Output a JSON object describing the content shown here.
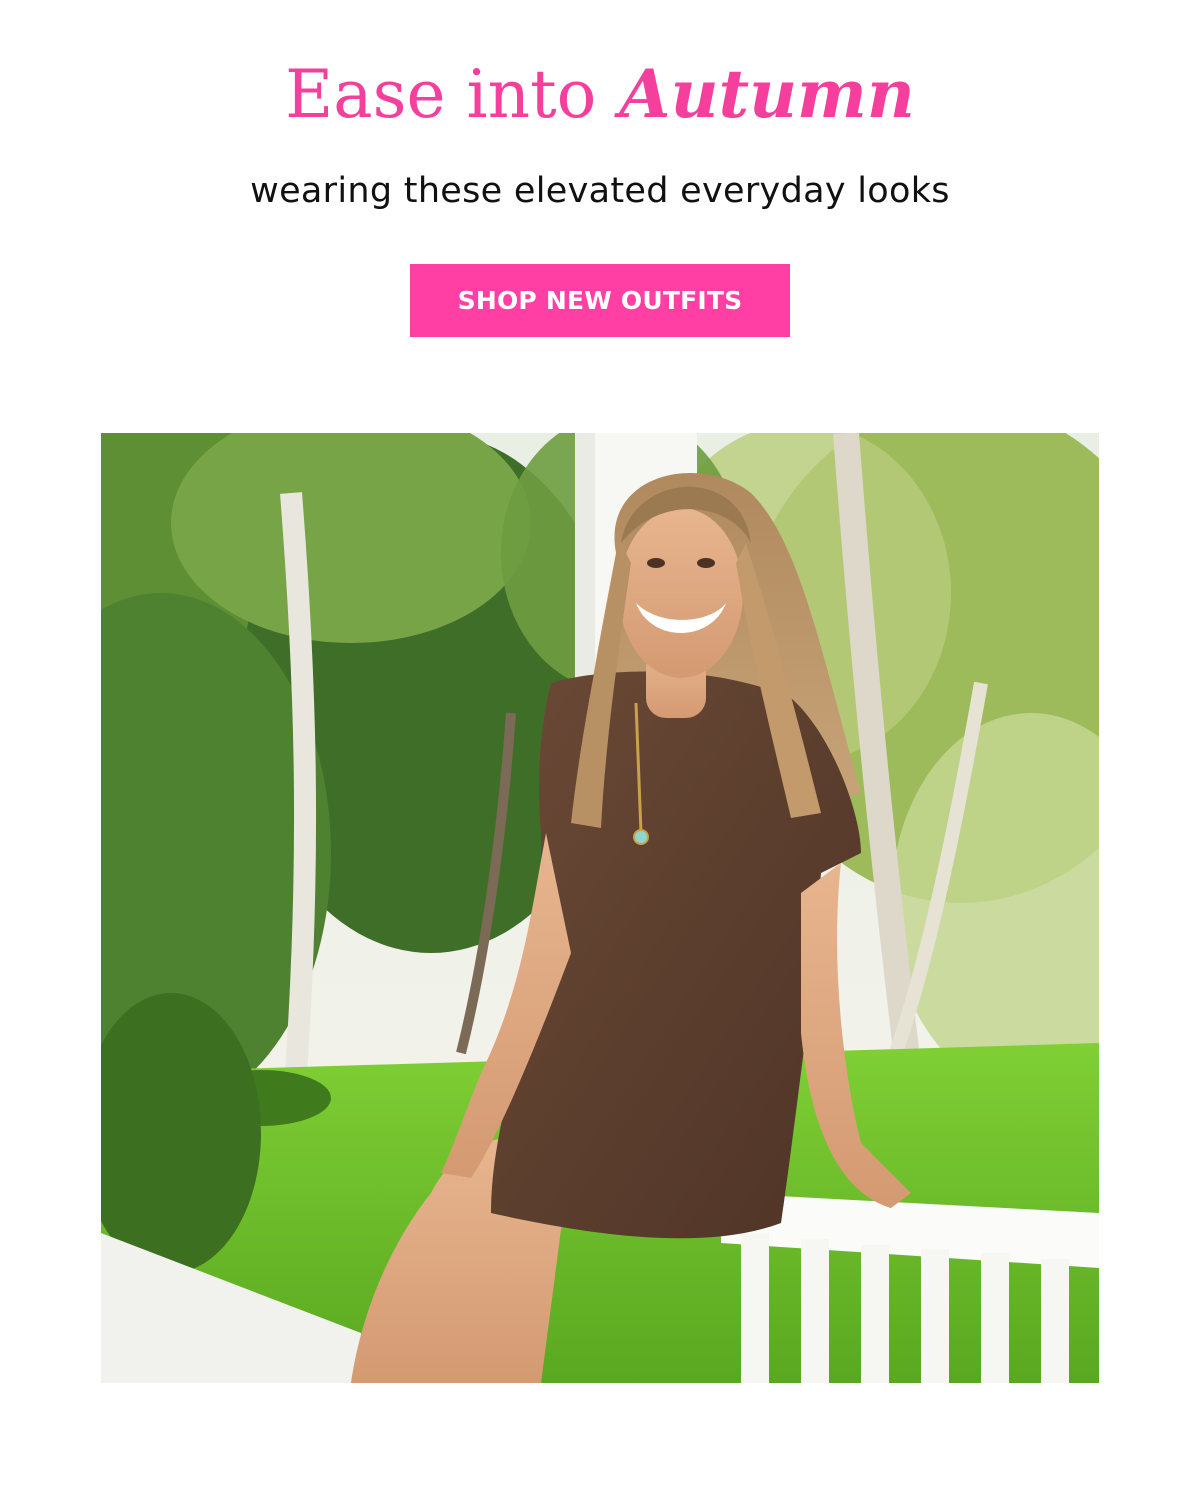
{
  "hero": {
    "headline_lead": "Ease into",
    "headline_accent": "Autumn",
    "subheadline": "wearing these elevated everyday looks",
    "cta_label": "SHOP NEW OUTFITS"
  },
  "colors": {
    "accent_pink": "#ff3fa4",
    "headline_pink": "#f43f9c",
    "text": "#111111",
    "background": "#ffffff"
  },
  "photo": {
    "icon": "lifestyle-photo"
  }
}
